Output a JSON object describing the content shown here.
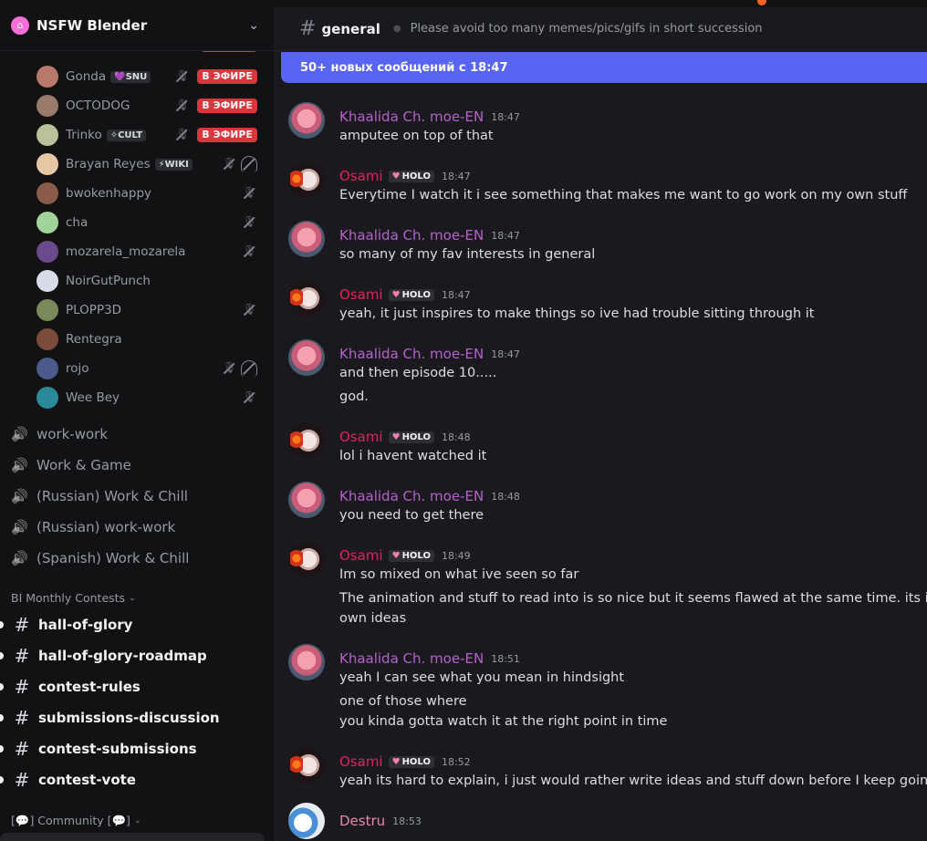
{
  "server": {
    "name": "NSFW Blender",
    "icon": "server-icon"
  },
  "voice_users": [
    {
      "name": "Gonda",
      "tag": "💜SNU",
      "muted": true,
      "deafened": false,
      "live": true,
      "avatar_color": "#b87a6a"
    },
    {
      "name": "OCTODOG",
      "tag": "",
      "muted": true,
      "deafened": false,
      "live": true,
      "avatar_color": "#9a7a6a"
    },
    {
      "name": "Trinko",
      "tag": "✧CULT",
      "muted": true,
      "deafened": false,
      "live": true,
      "avatar_color": "#b9c29a"
    },
    {
      "name": "Brayan Reyes",
      "tag": "⚡WIKI",
      "muted": true,
      "deafened": true,
      "live": false,
      "avatar_color": "#e6c8a4"
    },
    {
      "name": "bwokenhappy",
      "tag": "",
      "muted": true,
      "deafened": false,
      "live": false,
      "avatar_color": "#8a5a4a"
    },
    {
      "name": "cha",
      "tag": "",
      "muted": true,
      "deafened": false,
      "live": false,
      "avatar_color": "#9fd49a"
    },
    {
      "name": "mozarela_mozarela",
      "tag": "",
      "muted": true,
      "deafened": false,
      "live": false,
      "avatar_color": "#6a4a8a"
    },
    {
      "name": "NoirGutPunch",
      "tag": "",
      "muted": false,
      "deafened": false,
      "live": false,
      "avatar_color": "#d8dbe8"
    },
    {
      "name": "PLOPP3D",
      "tag": "",
      "muted": true,
      "deafened": false,
      "live": false,
      "avatar_color": "#7a8a5a"
    },
    {
      "name": "Rentegra",
      "tag": "",
      "muted": false,
      "deafened": false,
      "live": false,
      "avatar_color": "#7a4a3a"
    },
    {
      "name": "rojo",
      "tag": "",
      "muted": true,
      "deafened": true,
      "live": false,
      "avatar_color": "#4a5a8a"
    },
    {
      "name": "Wee Bey",
      "tag": "",
      "muted": true,
      "deafened": false,
      "live": false,
      "avatar_color": "#2a8a9a"
    }
  ],
  "live_label": "В ЭФИРЕ",
  "voice_channels": [
    "work-work",
    "Work & Game",
    "(Russian) Work & Chill",
    "(Russian) work-work",
    "(Spanish) Work & Chill"
  ],
  "categories": {
    "contests": "BI Monthly Contests",
    "community": "[💬] Community [💬]"
  },
  "text_channels": [
    "hall-of-glory",
    "hall-of-glory-roadmap",
    "contest-rules",
    "submissions-discussion",
    "contest-submissions",
    "contest-vote"
  ],
  "channel": {
    "name": "general",
    "topic": "Please avoid too many memes/pics/gifs in short succession"
  },
  "new_messages_banner": "50+ новых сообщений с 18:47",
  "messages": [
    {
      "author": "Khaalida Ch. moe-EN",
      "style": "khaal",
      "badge": "",
      "time": "18:47",
      "lines": [
        "amputee on top of that"
      ]
    },
    {
      "author": "Osami",
      "style": "osami",
      "badge": "HOLO",
      "time": "18:47",
      "lines": [
        "Everytime I watch it i see something that makes me want to go work on my own stuff"
      ]
    },
    {
      "author": "Khaalida Ch. moe-EN",
      "style": "khaal",
      "badge": "",
      "time": "18:47",
      "lines": [
        "so many of my fav interests in general"
      ]
    },
    {
      "author": "Osami",
      "style": "osami",
      "badge": "HOLO",
      "time": "18:47",
      "lines": [
        "yeah, it just inspires to make things so ive had trouble sitting through it"
      ]
    },
    {
      "author": "Khaalida Ch. moe-EN",
      "style": "khaal",
      "badge": "",
      "time": "18:47",
      "lines": [
        "and then episode 10.....",
        "god."
      ]
    },
    {
      "author": "Osami",
      "style": "osami",
      "badge": "HOLO",
      "time": "18:48",
      "lines": [
        "lol i havent watched it"
      ]
    },
    {
      "author": "Khaalida Ch. moe-EN",
      "style": "khaal",
      "badge": "",
      "time": "18:48",
      "lines": [
        "you need to get there"
      ]
    },
    {
      "author": "Osami",
      "style": "osami",
      "badge": "HOLO",
      "time": "18:49",
      "lines": [
        "Im so mixed on what ive seen so far",
        "The animation and stuff to read into is so nice but it seems flawed at the same time. its in a weir",
        "own ideas"
      ]
    },
    {
      "author": "Khaalida Ch. moe-EN",
      "style": "khaal",
      "badge": "",
      "time": "18:51",
      "lines": [
        "yeah I can see what you mean in hindsight",
        "one of those where",
        "you kinda gotta watch it at the right point in time"
      ]
    },
    {
      "author": "Osami",
      "style": "osami",
      "badge": "HOLO",
      "time": "18:52",
      "lines": [
        "yeah its hard to explain, i just would rather write ideas and stuff down before I keep going which"
      ]
    },
    {
      "author": "Destru",
      "style": "destru",
      "badge": "",
      "time": "18:53",
      "lines": []
    }
  ]
}
